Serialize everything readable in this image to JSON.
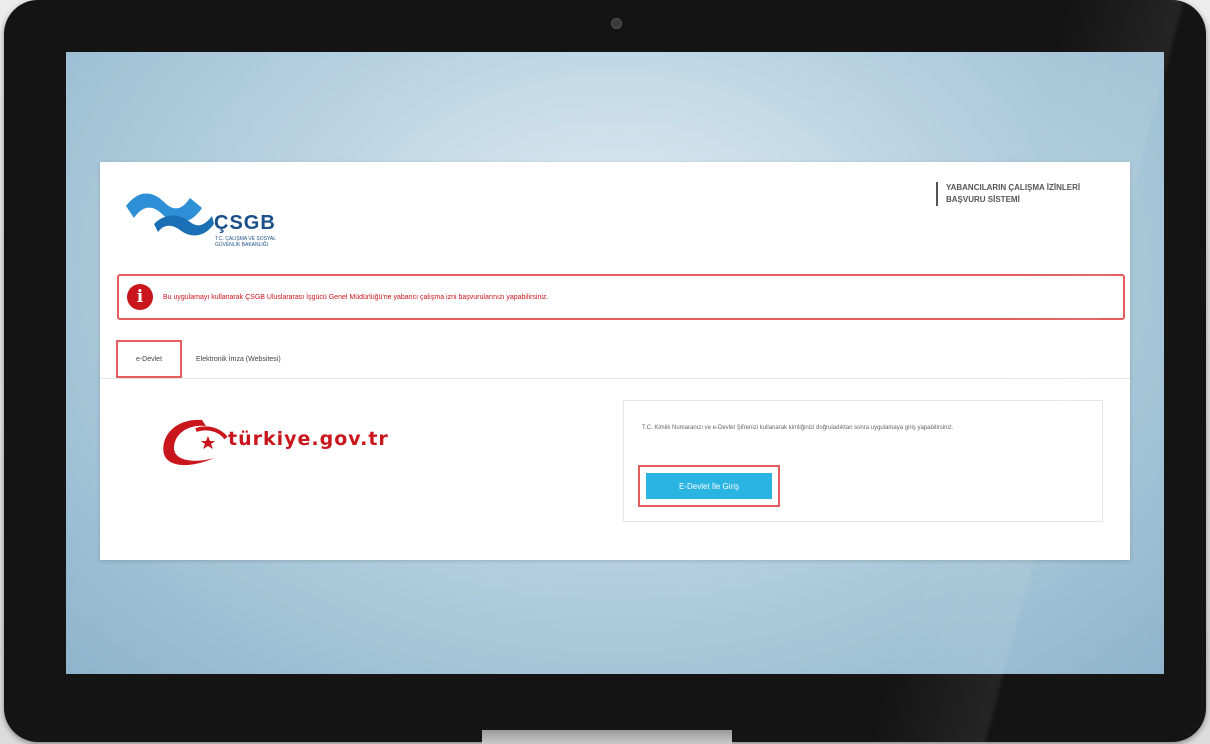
{
  "header": {
    "logo_name": "ÇSGB",
    "logo_subtitle": "T.C. ÇALIŞMA VE SOSYAL GÜVENLİK BAKANLIĞI",
    "system_title_line1": "YABANCILARIN ÇALIŞMA İZİNLERİ",
    "system_title_line2": "BAŞVURU SİSTEMİ"
  },
  "alert": {
    "text": "Bu uygulamayı kullanarak ÇSGB Uluslararası İşgücü Genel Müdürlüğü'ne yabancı çalışma izni başvurularınızı yapabilirsiniz.",
    "icon": "info-icon"
  },
  "tabs": [
    {
      "label": "e-Devlet",
      "active": true
    },
    {
      "label": "Elektronik İmza (Websitesi)",
      "active": false
    }
  ],
  "edevlet_logo_text": "türkiye.gov.tr",
  "login": {
    "text": "T.C. Kimlik Numaranızı ve e-Devlet Şifrenizi kullanarak kimliğinizi doğruladıktan sonra uygulamaya giriş yapabilirsiniz.",
    "button_label": "E-Devlet İle Giriş"
  },
  "colors": {
    "highlight_border": "#e35d5d",
    "button_bg": "#2ab4e2",
    "alert_red": "#c9161d",
    "brand_blue": "#1b4f8a"
  }
}
